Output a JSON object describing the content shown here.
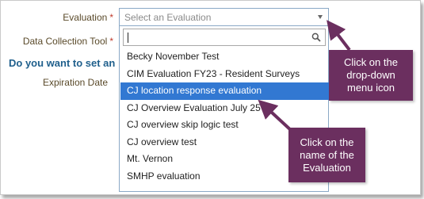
{
  "form": {
    "evaluation_label": "Evaluation",
    "data_tool_label": "Data Collection Tool",
    "required_mark": "*",
    "question_text": "Do you want to set an",
    "expiration_label": "Expiration Date"
  },
  "select": {
    "placeholder": "Select an Evaluation",
    "search_value": ""
  },
  "options": [
    "Becky November Test",
    "CIM Evaluation FY23 - Resident Surveys",
    "CJ location response evaluation",
    "CJ Overview Evaluation July 25",
    "CJ overview skip logic test",
    "CJ overview test",
    "Mt. Vernon",
    "SMHP evaluation"
  ],
  "selected_index": 2,
  "callouts": {
    "dropdown_icon": [
      "Click on the",
      "drop-down",
      "menu icon"
    ],
    "evaluation_name": [
      "Click on the",
      "name of the",
      "Evaluation"
    ]
  },
  "colors": {
    "accent": "#3278d2",
    "callout": "#6b2f5f",
    "question": "#1f5f8c",
    "required": "#c0392b"
  }
}
